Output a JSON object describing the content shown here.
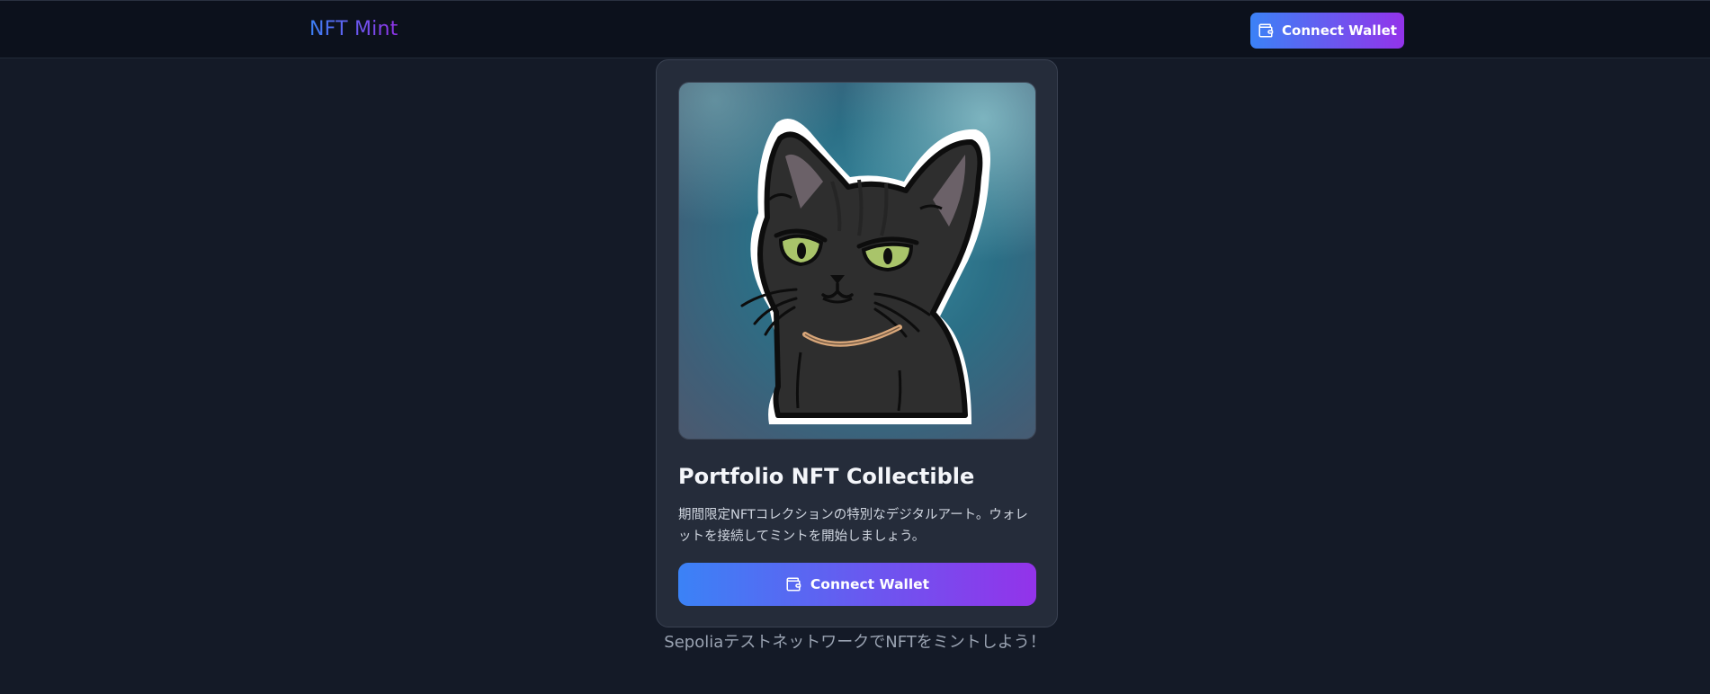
{
  "header": {
    "brand": "NFT Mint",
    "connect_label": "Connect Wallet",
    "connect_icon": "wallet-icon"
  },
  "card": {
    "image_alt": "black-cat-sticker-artwork",
    "title": "Portfolio NFT Collectible",
    "description": "期間限定NFTコレクションの特別なデジタルアート。ウォレットを接続してミントを開始しましょう。",
    "connect_label": "Connect Wallet",
    "connect_icon": "wallet-icon"
  },
  "footer": {
    "text": "SepoliaテストネットワークでNFTをミントしよう！"
  },
  "colors": {
    "background": "#141a27",
    "topbar": "#0c111c",
    "card": "#252c3a",
    "gradient_start": "#3b82f6",
    "gradient_end": "#9333ea"
  }
}
